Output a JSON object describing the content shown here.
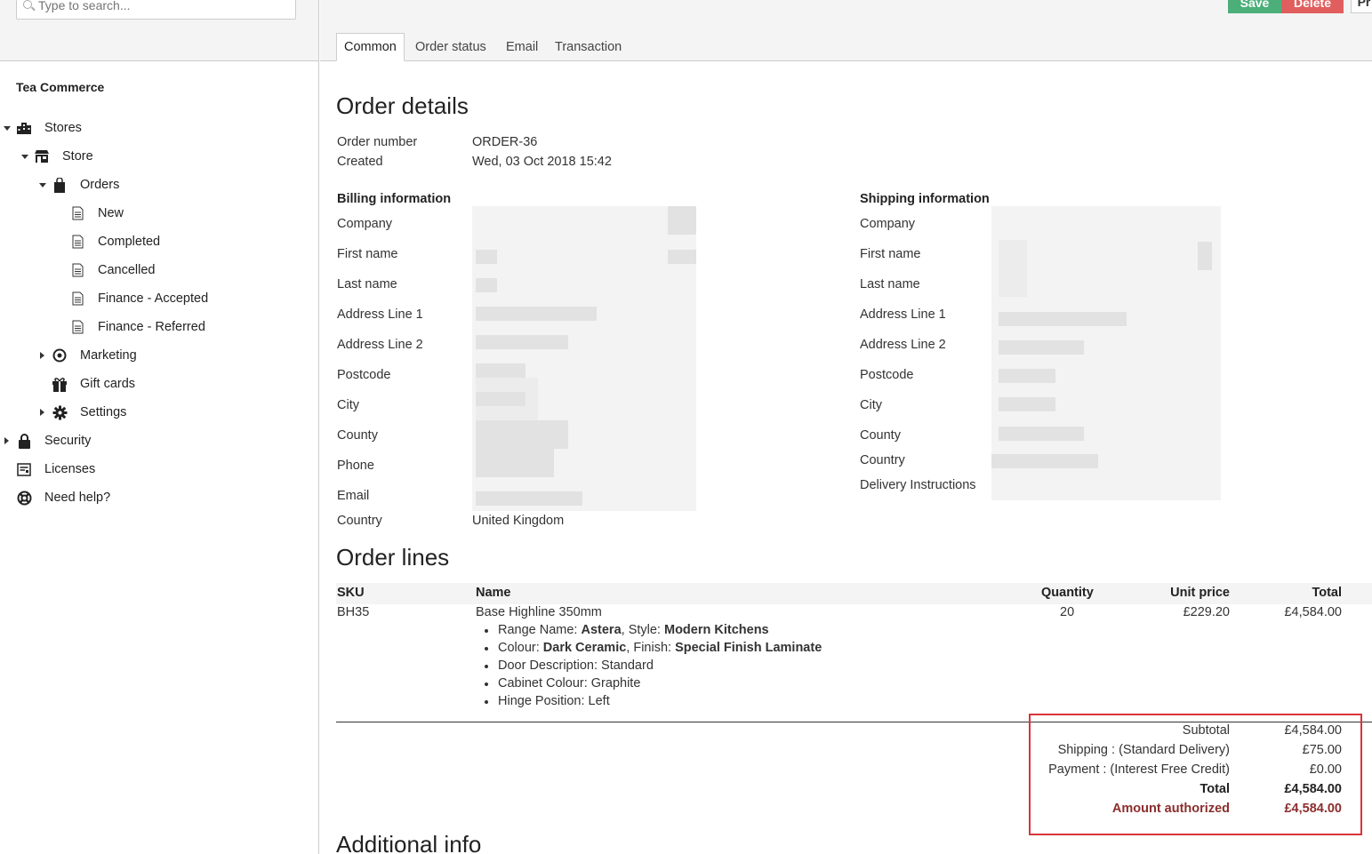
{
  "search": {
    "placeholder": "Type to search..."
  },
  "toolbar": {
    "save_label": "Save",
    "delete_label": "Delete",
    "more_label": "Pr"
  },
  "tabs": [
    "Common",
    "Order status",
    "Email",
    "Transaction"
  ],
  "tree": {
    "title": "Tea Commerce",
    "items": [
      {
        "label": "Stores"
      },
      {
        "label": "Store"
      },
      {
        "label": "Orders"
      },
      {
        "label": "New"
      },
      {
        "label": "Completed"
      },
      {
        "label": "Cancelled"
      },
      {
        "label": "Finance - Accepted"
      },
      {
        "label": "Finance - Referred"
      },
      {
        "label": "Marketing"
      },
      {
        "label": "Gift cards"
      },
      {
        "label": "Settings"
      },
      {
        "label": "Security"
      },
      {
        "label": "Licenses"
      },
      {
        "label": "Need help?"
      }
    ]
  },
  "order": {
    "title": "Order details",
    "number_label": "Order number",
    "number": "ORDER-36",
    "created_label": "Created",
    "created": "Wed, 03 Oct 2018 15:42"
  },
  "billing": {
    "title": "Billing information",
    "fields": [
      "Company",
      "First name",
      "Last name",
      "Address Line 1",
      "Address Line 2",
      "Postcode",
      "City",
      "County",
      "Phone",
      "Email",
      "Country"
    ],
    "country": "United Kingdom"
  },
  "shipping": {
    "title": "Shipping information",
    "fields": [
      "Company",
      "First name",
      "Last name",
      "Address Line 1",
      "Address Line 2",
      "Postcode",
      "City",
      "County",
      "Country",
      "Delivery Instructions"
    ]
  },
  "order_lines": {
    "title": "Order lines",
    "headers": {
      "sku": "SKU",
      "name": "Name",
      "quantity": "Quantity",
      "unit_price": "Unit price",
      "total": "Total"
    },
    "rows": [
      {
        "sku": "BH35",
        "name": "Base Highline 350mm",
        "quantity": "20",
        "unit_price": "£229.20",
        "total": "£4,584.00",
        "props": [
          {
            "a_key": "Range Name: ",
            "a_val": "Astera",
            "b_key": ", Style: ",
            "b_val": "Modern Kitchens"
          },
          {
            "a_key": "Colour: ",
            "a_val": "Dark Ceramic",
            "b_key": ", Finish: ",
            "b_val": "Special Finish Laminate"
          },
          {
            "text": "Door Description: Standard"
          },
          {
            "text": "Cabinet Colour: Graphite"
          },
          {
            "text": "Hinge Position: Left"
          }
        ]
      }
    ]
  },
  "totals": {
    "subtotal_label": "Subtotal",
    "subtotal": "£4,584.00",
    "shipping_label": "Shipping : (Standard Delivery)",
    "shipping": "£75.00",
    "payment_label": "Payment : (Interest Free Credit)",
    "payment": "£0.00",
    "total_label": "Total",
    "total": "£4,584.00",
    "authorized_label": "Amount authorized",
    "authorized": "£4,584.00"
  },
  "additional": {
    "title": "Additional info"
  },
  "colors": {
    "save": "#4caf7a",
    "delete": "#e15e5e",
    "highlight": "#d9343a",
    "authorized": "#8b2e2e"
  }
}
